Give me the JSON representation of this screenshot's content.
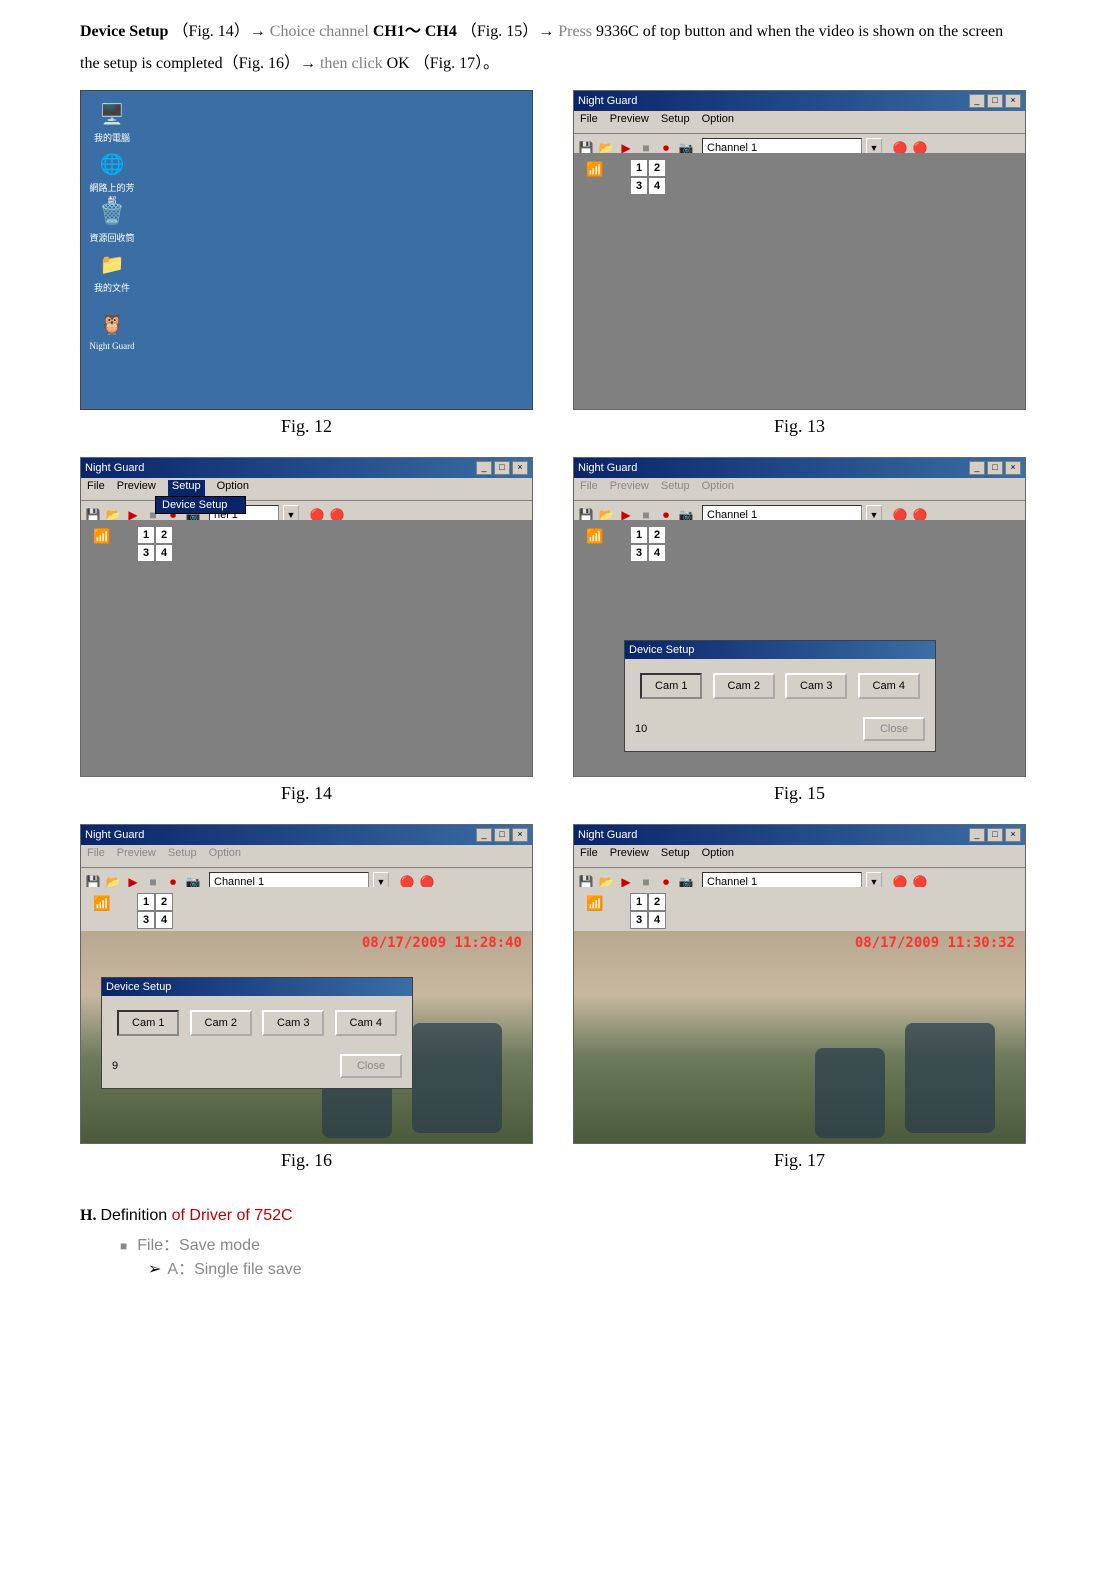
{
  "intro": {
    "seg1_bold": "Device Setup",
    "seg1_plain": "（Fig. 14）→ ",
    "seg2_gray": "Choice channel ",
    "seg2_bold": "CH1～  CH4",
    "seg2_plain": "（Fig. 15）→  ",
    "seg3_gray": "Press ",
    "seg3_plain": "9336C of top button and when the video is shown on the screen the setup is completed（Fig. 16）→ ",
    "seg4_gray": "then click ",
    "seg4_bold": "OK",
    "seg4_plain": "（Fig. 17）。"
  },
  "figures": {
    "f12": "Fig. 12",
    "f13": "Fig. 13",
    "f14": "Fig. 14",
    "f15": "Fig. 15",
    "f16": "Fig. 16",
    "f17": "Fig. 17"
  },
  "desktop_icons": [
    "我的電腦",
    "網路上的芳鄰",
    "資源回收筒",
    "我的文件",
    "Night Guard"
  ],
  "app": {
    "title": "Night Guard",
    "menu": {
      "file": "File",
      "preview": "Preview",
      "setup": "Setup",
      "option": "Option"
    },
    "channel_label": "Channel 1",
    "quad": [
      "1",
      "2",
      "3",
      "4"
    ],
    "dropdown_item": "Device Setup"
  },
  "dialog": {
    "title": "Device Setup",
    "cams": [
      "Cam 1",
      "Cam 2",
      "Cam 3",
      "Cam 4"
    ],
    "close": "Close",
    "counter_15": "10",
    "counter_16": "9"
  },
  "timestamps": {
    "f16": "08/17/2009  11:28:40",
    "f17": "08/17/2009  11:30:32"
  },
  "section_h": {
    "prefix": "H. ",
    "title_black": "Definition ",
    "title_red": "of Driver of 752C",
    "bullet1": "File：Save mode",
    "sub1": "A：Single file save"
  }
}
